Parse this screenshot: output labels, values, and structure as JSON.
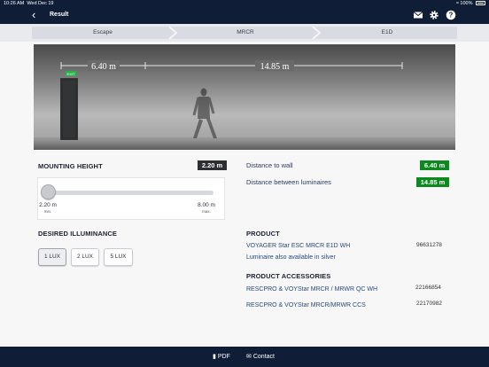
{
  "status_bar": {
    "time": "10:26 AM",
    "date": "Wed Dec 19",
    "battery": "100%"
  },
  "nav": {
    "title": "Result",
    "icons": [
      "mail-icon",
      "gear-icon",
      "help-icon",
      "back-chevron-icon"
    ]
  },
  "steps": [
    "Escape",
    "MRCR",
    "E1D"
  ],
  "hero": {
    "distance_to_wall": "6.40 m",
    "distance_between": "14.85 m",
    "exit_sign": "EXIT"
  },
  "mounting": {
    "label": "MOUNTING HEIGHT",
    "value": "2.20 m",
    "slider_fraction": 0.0,
    "min_value": "2.20 m",
    "min_label": "min.",
    "max_value": "8.00 m",
    "max_label": "max."
  },
  "illuminance": {
    "label": "DESIRED ILLUMINANCE",
    "options": [
      "1 LUX",
      "2 LUX",
      "5 LUX"
    ],
    "selected": "1 LUX"
  },
  "distances": {
    "wall_label": "Distance to wall",
    "wall_value": "6.40 m",
    "between_label": "Distance between luminaires",
    "between_value": "14.85 m"
  },
  "product": {
    "label": "PRODUCT",
    "name": "VOYAGER Star ESC MRCR E1D WH",
    "code": "96631278",
    "note": "Luminaire also available in silver"
  },
  "accessories": {
    "label": "PRODUCT ACCESSORIES",
    "items": [
      {
        "name": "RESCPRO & VOYStar MRCR / MRWR QC WH",
        "code": "22166854"
      },
      {
        "name": "RESCPRO & VOYStar MRCR/MRWR CCS",
        "code": "22170982"
      }
    ]
  },
  "footer": {
    "pdf": "PDF",
    "contact": "Contact"
  },
  "colors": {
    "navy": "#0f1d37",
    "green_badge": "#0d8a1e",
    "dark_badge": "#2d2f33"
  }
}
